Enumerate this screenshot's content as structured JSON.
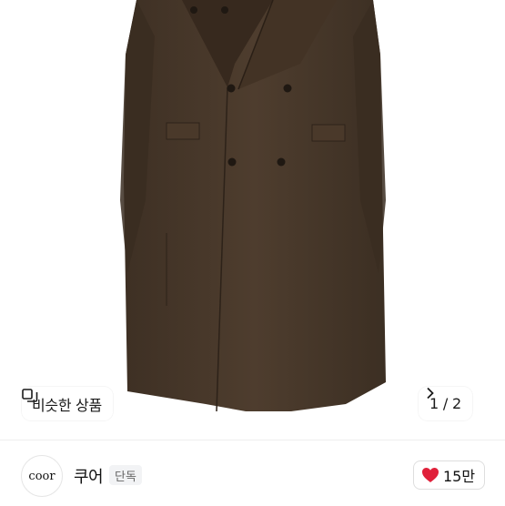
{
  "similar_button": {
    "label": "비슷한 상품",
    "icon": "similar-items-icon"
  },
  "pager": {
    "current": "1",
    "separator": "/",
    "total": "2",
    "next_icon": "chevron-right-icon"
  },
  "seller": {
    "avatar_text": "coor",
    "name": "쿠어",
    "badge": "단독"
  },
  "like": {
    "icon": "heart-icon",
    "count": "15만",
    "color": "#e0203a"
  },
  "colors": {
    "coat": "#4a3a2c",
    "background": "#ffffff"
  }
}
